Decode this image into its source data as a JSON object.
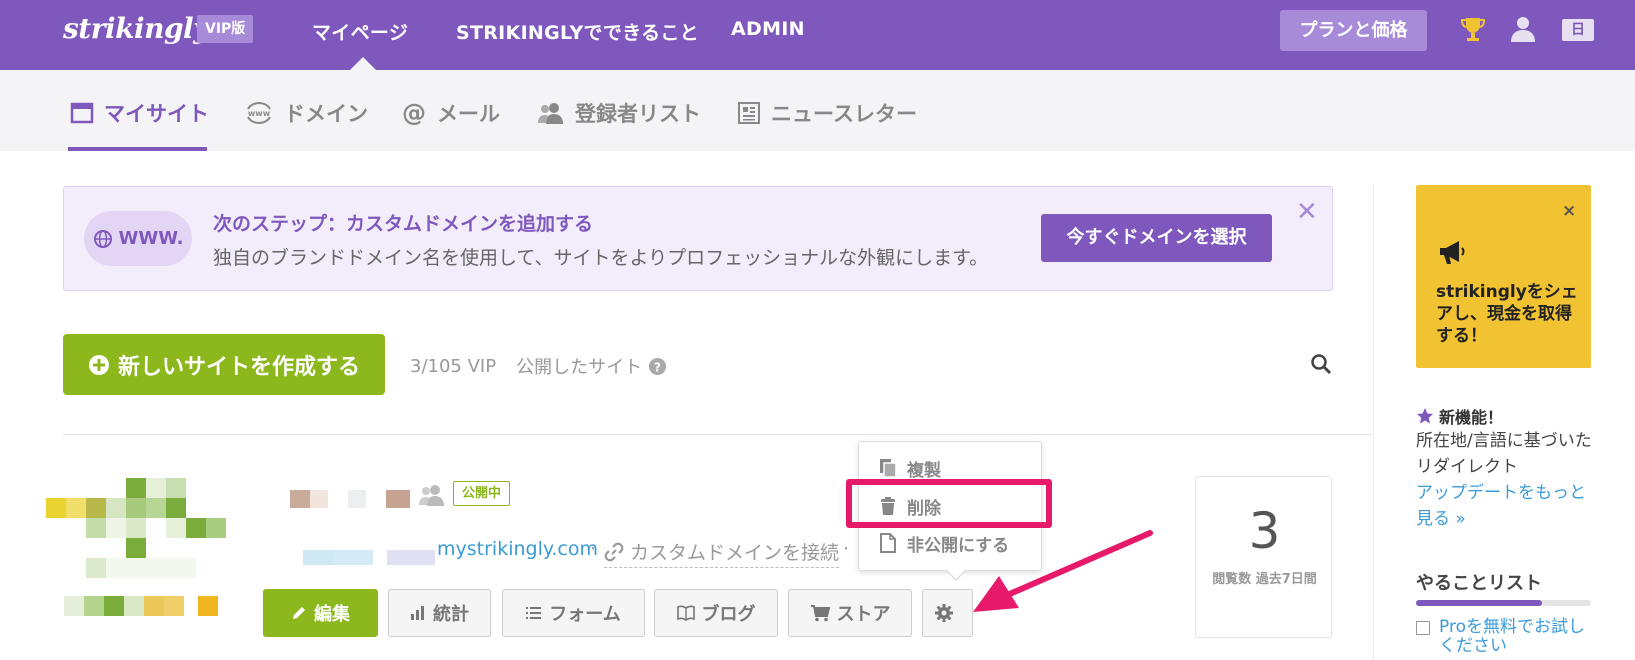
{
  "header": {
    "logo": "strikingly",
    "vip_badge": "VIP版",
    "nav": [
      "マイページ",
      "STRIKINGLYでできること",
      "ADMIN"
    ],
    "plan_button": "プランと価格",
    "lang": "日",
    "brand_color": "#7f58bd"
  },
  "subnav": {
    "tabs": [
      {
        "label": "マイサイト",
        "icon": "browser-window-icon"
      },
      {
        "label": "ドメイン",
        "icon": "www-icon"
      },
      {
        "label": "メール",
        "icon": "at-icon"
      },
      {
        "label": "登録者リスト",
        "icon": "users-icon"
      },
      {
        "label": "ニュースレター",
        "icon": "newsletter-icon"
      }
    ],
    "active_index": 0
  },
  "banner": {
    "pill": "WWW.",
    "title": "次のステップ：カスタムドメインを追加する",
    "description": "独自のブランドドメイン名を使用して、サイトをよりプロフェッショナルな外観にします。",
    "button": "今すぐドメインを選択"
  },
  "actions": {
    "new_site": "新しいサイトを作成する",
    "count": "3/105 VIP",
    "published_label": "公開したサイト"
  },
  "site": {
    "status": "公開中",
    "url": "mystrikingly.com",
    "custom_domain": "カスタムドメインを接続",
    "buttons": [
      "編集",
      "統計",
      "フォーム",
      "ブログ",
      "ストア"
    ],
    "views": "3",
    "views_label": "閲覧数 過去7日間",
    "accent_color": "#8cb81e"
  },
  "dropdown": {
    "items": [
      "複製",
      "削除",
      "非公開にする"
    ],
    "highlighted": "削除",
    "highlight_color": "#e6196b"
  },
  "sidebar": {
    "promo": "strikinglyをシェアし、現金を取得する！",
    "promo_close": "×",
    "new_feature_title": "新機能！",
    "new_feature_desc": "所在地/言語に基づいたリダイレクト",
    "new_feature_link": "アップデートをもっと見る »",
    "todo_title": "やることリスト",
    "todo_progress": 0.72,
    "todo_item": "Proを無料でお試しください"
  }
}
